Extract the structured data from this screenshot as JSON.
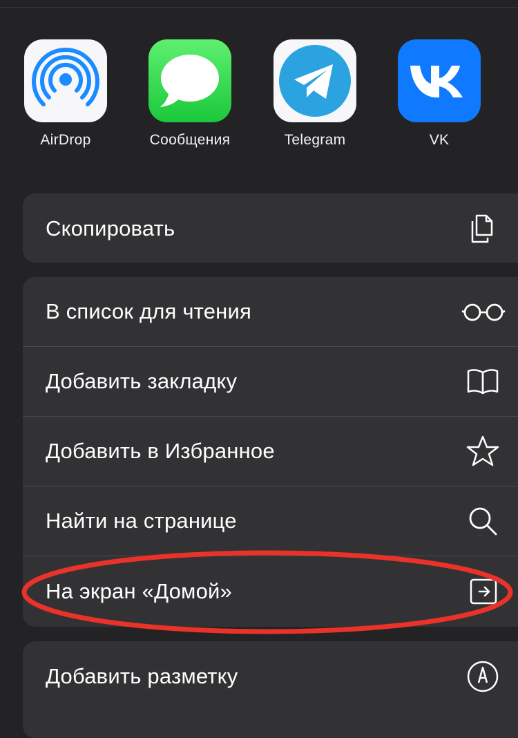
{
  "apps": [
    {
      "label": "AirDrop",
      "icon": "airdrop-icon"
    },
    {
      "label": "Сообщения",
      "icon": "messages-icon"
    },
    {
      "label": "Telegram",
      "icon": "telegram-icon"
    },
    {
      "label": "VK",
      "icon": "vk-icon"
    }
  ],
  "actions_group1": [
    {
      "label": "Скопировать",
      "icon": "copy-icon"
    }
  ],
  "actions_group2": [
    {
      "label": "В список для чтения",
      "icon": "glasses-icon"
    },
    {
      "label": "Добавить закладку",
      "icon": "book-icon"
    },
    {
      "label": "Добавить в Избранное",
      "icon": "star-icon"
    },
    {
      "label": "Найти на странице",
      "icon": "search-icon"
    },
    {
      "label": "На экран «Домой»",
      "icon": "add-to-home-icon"
    }
  ],
  "actions_group3": [
    {
      "label": "Добавить разметку",
      "icon": "markup-icon"
    }
  ],
  "colors": {
    "background": "#232325",
    "row_background": "#323234",
    "highlight": "#e8322a",
    "vk_blue": "#0f7aff",
    "airdrop_blue": "#1a8cff",
    "telegram_blue": "#2aa3e0"
  }
}
